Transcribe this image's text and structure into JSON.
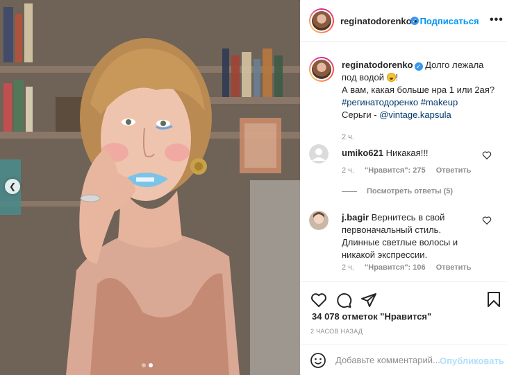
{
  "post": {
    "username": "reginatodorenko",
    "follow_label": "Подписаться",
    "more_label": "•••"
  },
  "caption": {
    "username": "reginatodorenko",
    "text_line1": "Долго лежала",
    "text_line2": "под водой",
    "text_after_emoji": "!",
    "text_line3": "А вам, какая больше нра 1 или 2ая?",
    "hashtags": "#регинатодоренко #makeup",
    "earrings_label": "Серьги - ",
    "earrings_link": "@vintage.kapsula",
    "time": "2 ч."
  },
  "comments": [
    {
      "username": "umiko621",
      "text": "Никакая!!!",
      "time": "2 ч.",
      "likes": "\"Нравится\": 275",
      "reply_label": "Ответить",
      "view_replies": "Посмотреть ответы (5)"
    },
    {
      "username": "j.bagir",
      "text_line1": "Вернитесь в свой",
      "text_line2": "первоначальный стиль.",
      "text_line3": "Длинные светлые волосы и",
      "text_line4": "никакой экспрессии.",
      "time": "2 ч.",
      "likes": "\"Нравится\": 106",
      "reply_label": "Ответить"
    }
  ],
  "likes_summary": "34 078 отметок \"Нравится\"",
  "date_label": "2 ЧАСОВ НАЗАД",
  "add_comment": {
    "placeholder": "Добавьте комментарий...",
    "publish_label": "Опубликовать"
  },
  "carousel": {
    "current": 2,
    "total": 2
  },
  "colors": {
    "accent": "#0095f6",
    "publish_disabled": "#b2dffc",
    "verified": "#3897f0",
    "muted": "#8e8e8e",
    "lipstick": "#7cc3e8"
  }
}
